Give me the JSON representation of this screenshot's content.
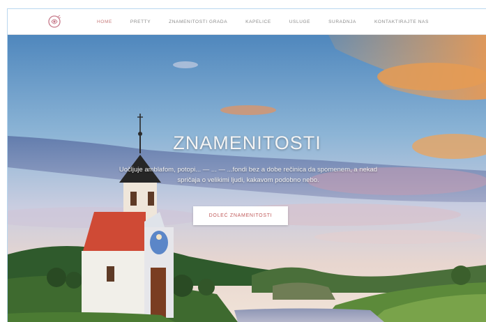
{
  "nav": {
    "items": [
      {
        "label": "Home"
      },
      {
        "label": "Pretty"
      },
      {
        "label": "Znamenitosti grada"
      },
      {
        "label": "Kapelice"
      },
      {
        "label": "Usluge"
      },
      {
        "label": "Suradnja"
      },
      {
        "label": "Kontaktirajte nas"
      }
    ]
  },
  "hero": {
    "title": "ZNAMENITOSTI",
    "text_line1": "Uočljuje amblafom, potopi... — ... — ...fondi bez a dobe rečinica da spomenem, a nekad",
    "text_line2": "spričaja o velikimi ljudi, kakavom podobno nebo.",
    "button_label": "Doleć znamenitosti"
  },
  "colors": {
    "accent": "#c05a5a",
    "roof": "#cf4a35",
    "sky_top": "#5a8fc0"
  }
}
